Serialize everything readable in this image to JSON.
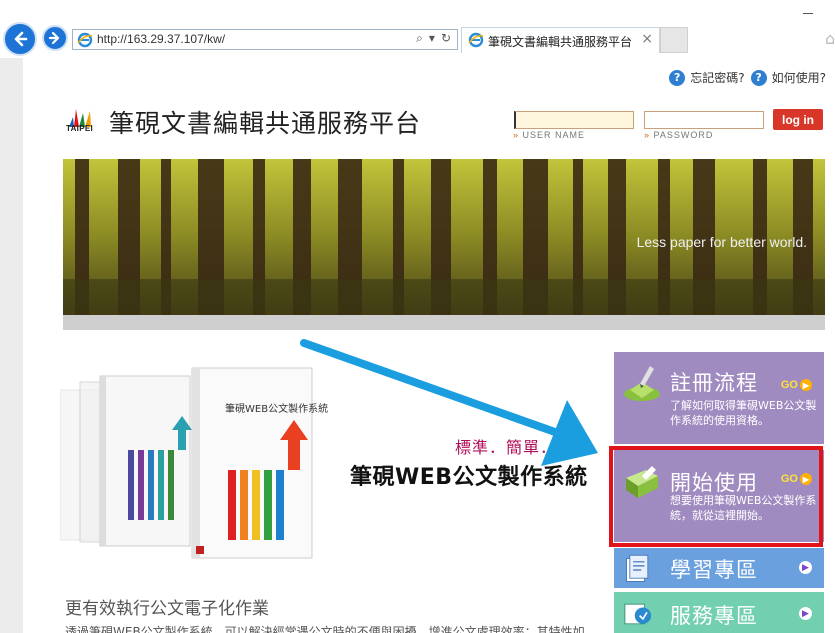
{
  "browser": {
    "url": "http://163.29.37.107/kw/",
    "tab_title": "筆硯文書編輯共通服務平台",
    "tab_close": "×"
  },
  "help": {
    "forgot_password": "忘記密碼?",
    "how_to_use": "如何使用?"
  },
  "header": {
    "logo_text": "TAIPEI",
    "site_title": "筆硯文書編輯共通服務平台"
  },
  "login": {
    "user_label": "USER NAME",
    "password_label": "PASSWORD",
    "button": "log in"
  },
  "banner": {
    "tagline": "Less paper for better world."
  },
  "product": {
    "slogan": "標準．簡單．",
    "name": "筆硯WEB公文製作系統",
    "box_label": "筆硯WEB公文製作系統"
  },
  "main": {
    "heading": "更有效執行公文電子化作業",
    "body": "透過筆硯WEB公文製作系統，可以解決經常遇公文時的不便與困擾，增進公文處理效率；其特性如"
  },
  "menu": {
    "go": "GO",
    "register": {
      "title": "註冊流程",
      "desc": "了解如何取得筆硯WEB公文製作系統的使用資格。"
    },
    "start": {
      "title": "開始使用",
      "desc": "想要使用筆硯WEB公文製作系統，就從這裡開始。"
    },
    "learn": {
      "title": "學習專區"
    },
    "service": {
      "title": "服務專區"
    }
  },
  "colors": {
    "accent_red": "#e0131b",
    "login_button": "#d9362a",
    "card_purple": "#a08bc0",
    "card_blue": "#6aa0de",
    "card_green": "#72cfb0",
    "annotation_arrow": "#1a9ee0"
  }
}
